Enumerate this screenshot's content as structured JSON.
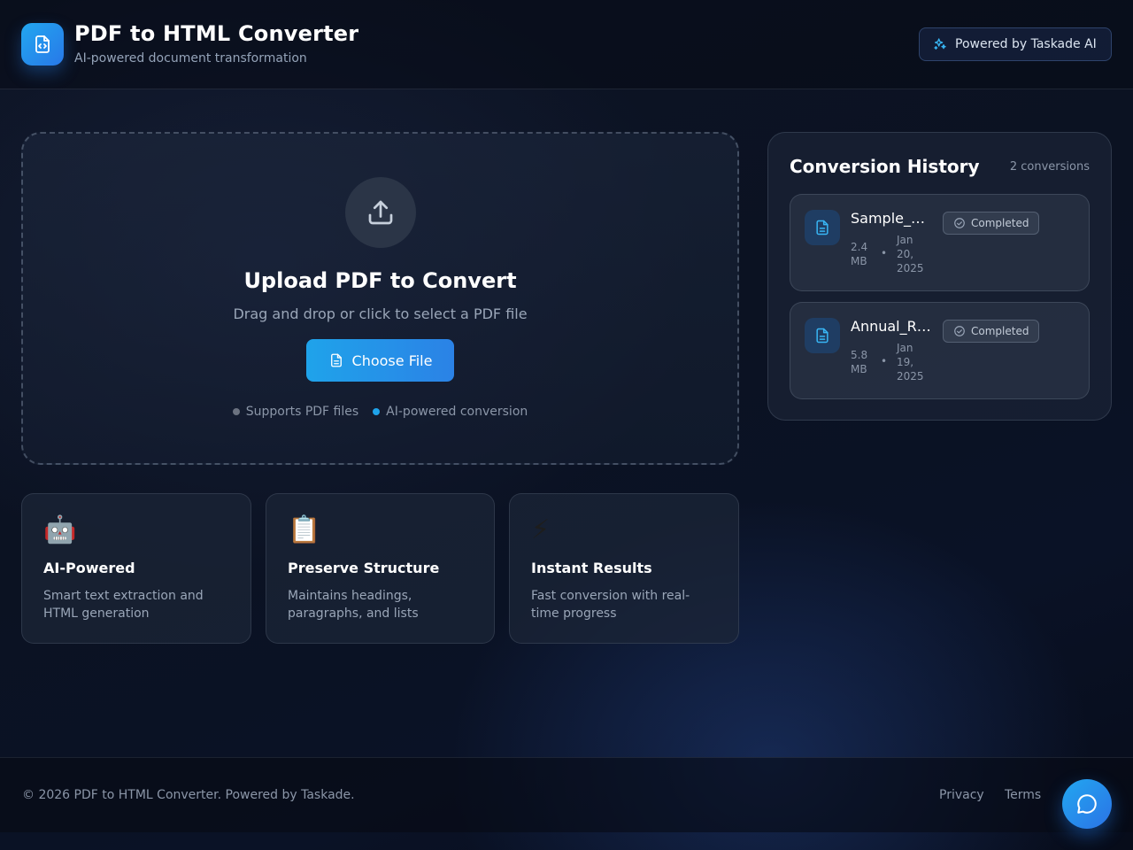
{
  "header": {
    "title": "PDF to HTML Converter",
    "subtitle": "AI-powered document transformation",
    "powered_label": "Powered by Taskade AI"
  },
  "upload": {
    "title": "Upload PDF to Convert",
    "description": "Drag and drop or click to select a PDF file",
    "button_label": "Choose File",
    "tags": [
      {
        "label": "Supports PDF files",
        "color": "#6b7280"
      },
      {
        "label": "AI-powered conversion",
        "color": "#1fa3ea"
      }
    ]
  },
  "features": [
    {
      "icon": "🤖",
      "icon_name": "robot-icon",
      "title": "AI-Powered",
      "description": "Smart text extraction and HTML generation"
    },
    {
      "icon": "📋",
      "icon_name": "clipboard-icon",
      "title": "Preserve Structure",
      "description": "Maintains headings, paragraphs, and lists"
    },
    {
      "icon": "⚡",
      "icon_name": "lightning-icon",
      "title": "Instant Results",
      "description": "Fast conversion with real-time progress"
    }
  ],
  "history": {
    "title": "Conversion History",
    "count": "2 conversions",
    "items": [
      {
        "name": "Sample_…",
        "size": "2.4 MB",
        "date": "Jan 20, 2025",
        "status": "Completed"
      },
      {
        "name": "Annual_R…",
        "size": "5.8 MB",
        "date": "Jan 19, 2025",
        "status": "Completed"
      }
    ]
  },
  "footer": {
    "copyright": "© 2026 PDF to HTML Converter. Powered by Taskade.",
    "links": [
      "Privacy",
      "Terms"
    ]
  },
  "colors": {
    "accent": "#1fa3ea",
    "accent_dark": "#2b82e6",
    "background": "#0b1222"
  }
}
